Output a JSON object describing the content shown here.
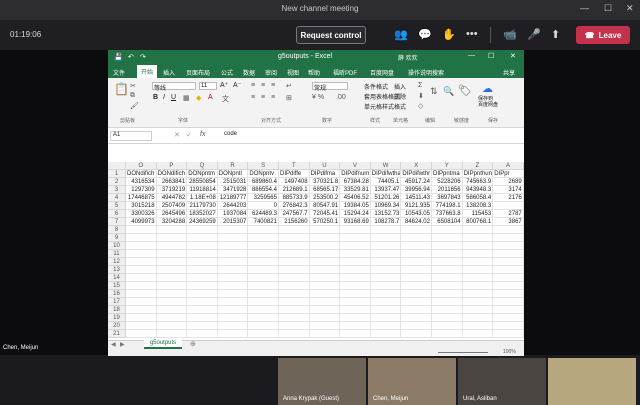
{
  "window": {
    "title": "New channel meeting"
  },
  "toolbar": {
    "timer": "01:19:06",
    "request_control_label": "Request control",
    "leave_label": "Leave"
  },
  "local_participant_label": "Chen, Meijun",
  "excel": {
    "title": "g5outputs - Excel",
    "user": "薛 欢欢",
    "tabs": [
      "文件",
      "开始",
      "插入",
      "页面布局",
      "公式",
      "数据",
      "审阅",
      "视图",
      "帮助",
      "福昕PDF",
      "百度网盘",
      "操作说明搜索"
    ],
    "share_label": "共享",
    "ribbon": {
      "font_name": "等线",
      "font_size": "11",
      "number_format": "常规",
      "conditional_format": "条件格式",
      "format_as_table": "套用表格格式",
      "cell_styles": "单元格样式",
      "insert": "插入",
      "delete": "删除",
      "format": "格式",
      "groups": [
        "剪贴板",
        "字体",
        "对齐方式",
        "数字",
        "样式",
        "单元格",
        "编辑",
        "敏感度",
        "保存"
      ],
      "baidu_save": "保存到\n百度网盘",
      "sensitivity": "敏感度"
    },
    "name_box": "A1",
    "formula_value": "code",
    "columns": [
      "O",
      "P",
      "Q",
      "R",
      "S",
      "T",
      "U",
      "V",
      "W",
      "X",
      "Y",
      "Z",
      "A"
    ],
    "rows": [
      [
        "DONdifich",
        "DONdifich",
        "DONpntm",
        "DONpntl",
        "DONpntv",
        "DIPdiffe",
        "DIPdifma",
        "DIPdifnum",
        "DIPdifwtha",
        "DIPdifwthr",
        "DIPpntma",
        "DIPpnthun",
        "DIPpr"
      ],
      [
        "4316534",
        "2663841",
        "28550854",
        "2515031",
        "689860.4",
        "1497408",
        "370321.8",
        "67384.28",
        "74405.1",
        "45917.24",
        "5228206",
        "745663.9",
        "2689"
      ],
      [
        "1297309",
        "3719219",
        "11918814",
        "3471928",
        "886554.4",
        "212689.1",
        "68565.17",
        "33529.81",
        "13937.47",
        "39956.94",
        "2011656",
        "943948.3",
        "3174"
      ],
      [
        "17446875",
        "4944782",
        "1.18E+08",
        "12189777",
        "3259565",
        "885733.9",
        "253500.2",
        "45406.52",
        "51201.26",
        "14511.43",
        "3697843",
        "586058.4",
        "2176"
      ],
      [
        "3015218",
        "2507409",
        "21179730",
        "2644203",
        "0",
        "276842.3",
        "80547.91",
        "19384.05",
        "10969.34",
        "9121.935",
        "774198.1",
        "138208.3",
        ""
      ],
      [
        "3300326",
        "2645496",
        "18352027",
        "1937084",
        "624489.3",
        "247567.7",
        "72045.41",
        "15294.24",
        "13152.73",
        "10543.05",
        "737663.8",
        "115453",
        "2787"
      ],
      [
        "4099973",
        "3204288",
        "24369259",
        "2015307",
        "7400821",
        "2156260",
        "570250.1",
        "93168.69",
        "108278.7",
        "84624.02",
        "6508104",
        "800768.1",
        "3867"
      ]
    ],
    "sheet_tab": "g5outputs",
    "zoom": "100%"
  },
  "participants": [
    "Anna Krypak (Guest)",
    "Chen, Meijun",
    "Ural, Asliban",
    ""
  ]
}
